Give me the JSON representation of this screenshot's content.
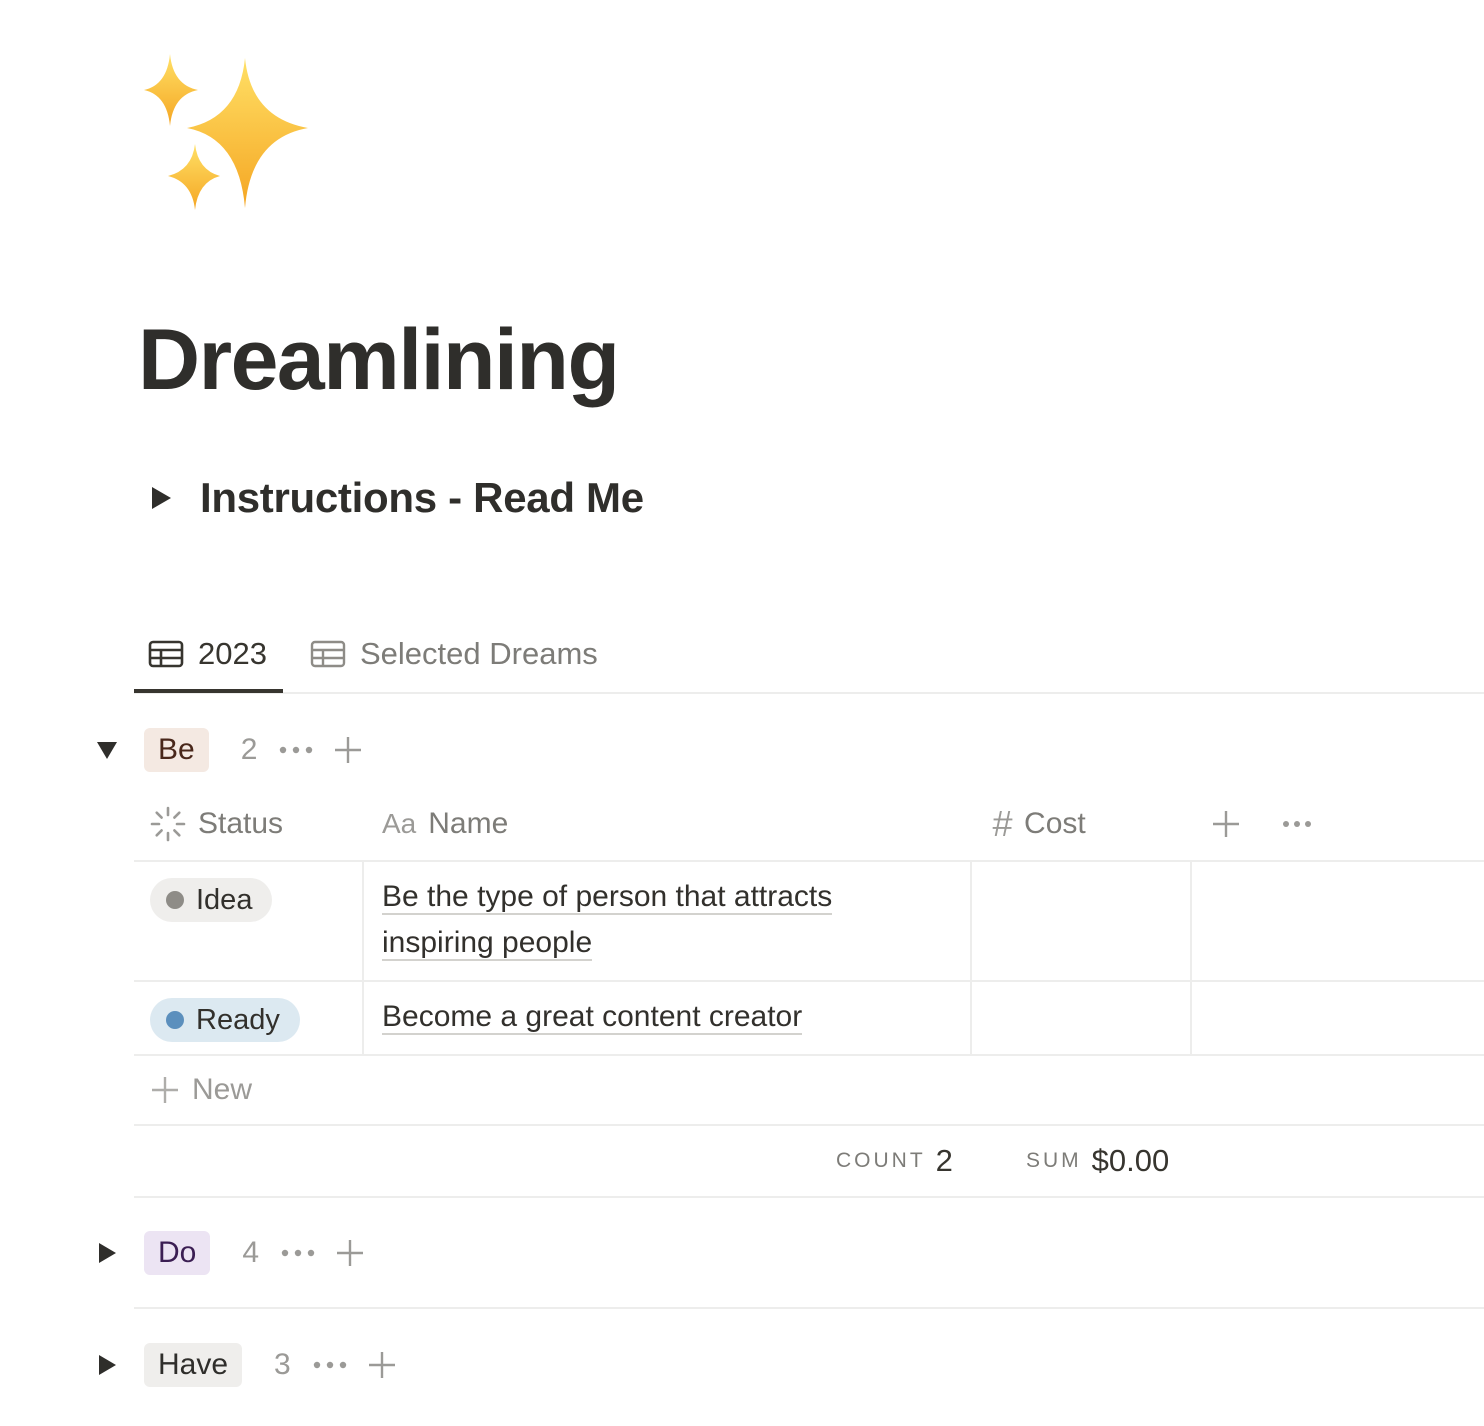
{
  "page": {
    "icon": "sparkles-icon",
    "title": "Dreamlining"
  },
  "toggle": {
    "heading": "Instructions - Read Me",
    "icon": "triangle-right-icon"
  },
  "tabs": [
    {
      "label": "2023",
      "icon": "table-icon",
      "active": true
    },
    {
      "label": "Selected Dreams",
      "icon": "table-icon",
      "active": false
    }
  ],
  "groups": [
    {
      "label": "Be",
      "count": "2",
      "expanded": true,
      "bg": "#f4e9e2",
      "fg": "#49271a"
    },
    {
      "label": "Do",
      "count": "4",
      "expanded": false,
      "bg": "#ece4f3",
      "fg": "#3b1e53"
    },
    {
      "label": "Have",
      "count": "3",
      "expanded": false,
      "bg": "#efeeec",
      "fg": "#2f2e2b"
    }
  ],
  "table": {
    "columns": [
      {
        "label": "Status",
        "icon": "status-spinner-icon"
      },
      {
        "label": "Name",
        "icon": "text-aa-icon",
        "icon_text": "Aa"
      },
      {
        "label": "Cost",
        "icon": "number-hash-icon",
        "icon_text": "#"
      }
    ],
    "rows": [
      {
        "status": "Idea",
        "status_dot": "#8e8c87",
        "status_bg": "#efeeec",
        "name": "Be the type of person that attracts inspiring people"
      },
      {
        "status": "Ready",
        "status_dot": "#5b8fbd",
        "status_bg": "#dce9f1",
        "name": "Become a great content creator"
      }
    ],
    "new_label": "New",
    "count_label": "COUNT",
    "count_value": "2",
    "sum_label": "SUM",
    "sum_value": "$0.00"
  }
}
